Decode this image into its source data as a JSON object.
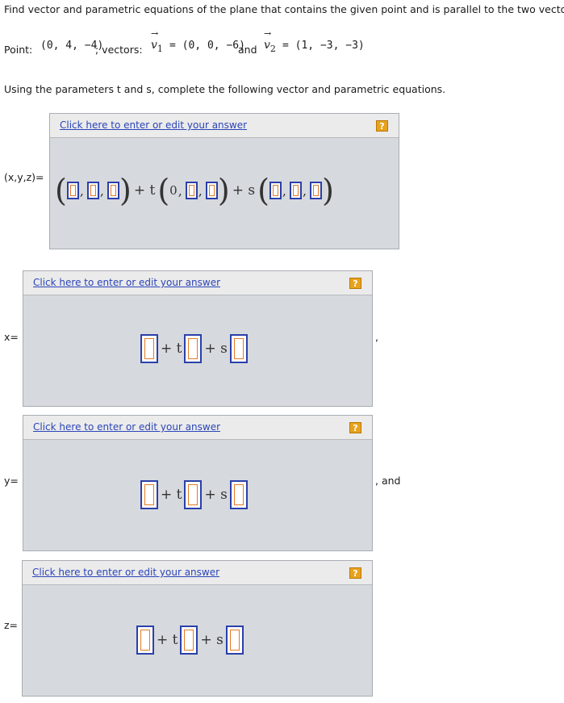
{
  "question": {
    "instruction": "Find vector and parametric equations of the plane that contains the given point and is parallel to the two vectors.",
    "point_label": "Point:",
    "point_value": "(0, 4, −4)",
    "vectors_label": "; vectors:",
    "v1_symbol": "v",
    "v1_subscript": "1",
    "v1_value": "= (0, 0, −6)",
    "and_word": "and",
    "v2_symbol": "v",
    "v2_subscript": "2",
    "v2_value": "= (1, −3, −3)",
    "arrow": "→",
    "prompt_text": "Using the parameters t and s, complete the following vector and parametric equations."
  },
  "panel_common": {
    "link_text": "Click here to enter or edit your answer",
    "help_label": "?"
  },
  "vector_equation": {
    "label": "(x,y,z)=",
    "plus_t": "+ t",
    "plus_s": "+ s",
    "fixed_first_component": "0"
  },
  "parametric": {
    "x_label": "x=",
    "y_label": "y=",
    "z_label": "z=",
    "x_suffix": ",",
    "y_suffix": ", and",
    "plus_t": "+ t",
    "plus_s": "+ s"
  }
}
